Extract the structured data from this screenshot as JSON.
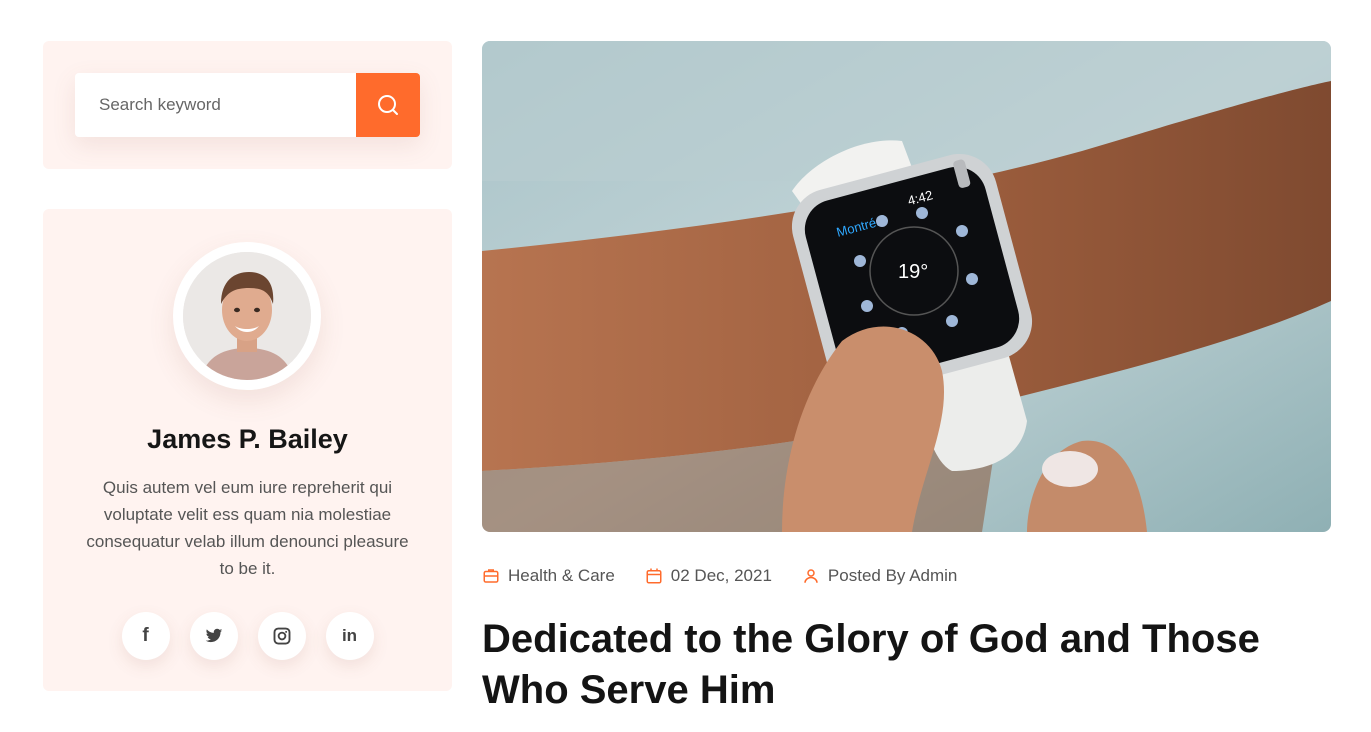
{
  "search": {
    "placeholder": "Search keyword"
  },
  "author": {
    "name": "James P. Bailey",
    "bio": "Quis autem vel eum iure repreherit qui voluptate velit ess quam nia molestiae consequatur velab illum denounci pleasure to be it."
  },
  "socials": [
    {
      "label": "f",
      "icon": "facebook-icon"
    },
    {
      "label": "twitter",
      "icon": "twitter-icon"
    },
    {
      "label": "instagram",
      "icon": "instagram-icon"
    },
    {
      "label": "in",
      "icon": "linkedin-icon"
    }
  ],
  "post": {
    "category": "Health & Care",
    "date": "02 Dec, 2021",
    "author": "Posted By Admin",
    "title": "Dedicated to the Glory of God and Those Who Serve Him"
  },
  "colors": {
    "accent": "#ff6b2c",
    "card_bg": "#fff3f0"
  }
}
